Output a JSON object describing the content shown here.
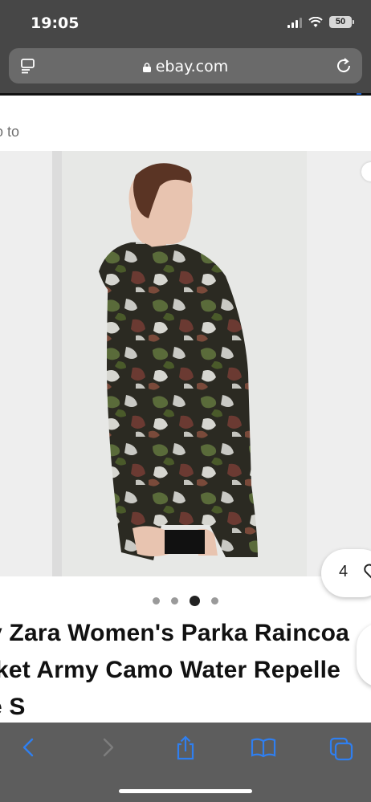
{
  "status_bar": {
    "time": "19:05",
    "battery": "50"
  },
  "browser": {
    "url": "ebay.com"
  },
  "page": {
    "back_link": "to",
    "watch_count": "4",
    "gallery": {
      "image_count": 4,
      "active_index": 2
    },
    "title_lines": [
      "v Zara Women's Parka Raincoa",
      "ket Army Camo Water Repelle",
      "e S"
    ]
  },
  "colors": {
    "chrome": "#474747",
    "toolbar": "#5d5d5d",
    "link_blue": "#1f6fde"
  }
}
